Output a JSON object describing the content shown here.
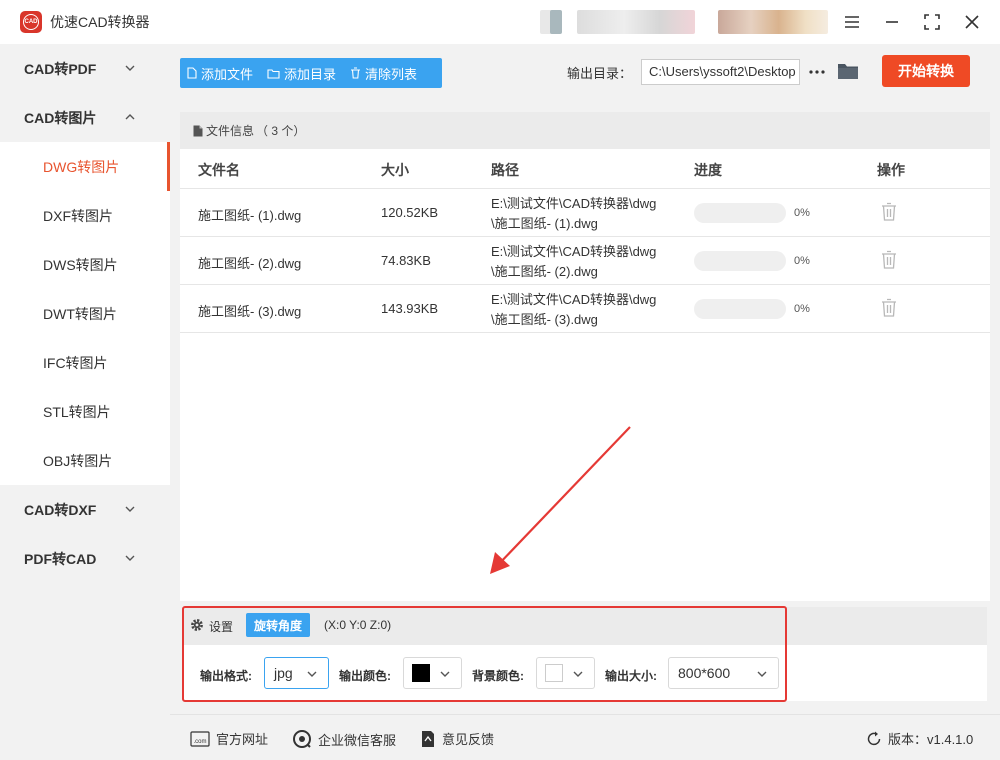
{
  "app": {
    "title": "优速CAD转换器",
    "logo_text": "CAD"
  },
  "sidebar": {
    "groups": [
      {
        "label": "CAD转PDF"
      },
      {
        "label": "CAD转图片"
      },
      {
        "label": "CAD转DXF"
      },
      {
        "label": "PDF转CAD"
      }
    ],
    "items": [
      {
        "label": "DWG转图片"
      },
      {
        "label": "DXF转图片"
      },
      {
        "label": "DWS转图片"
      },
      {
        "label": "DWT转图片"
      },
      {
        "label": "IFC转图片"
      },
      {
        "label": "STL转图片"
      },
      {
        "label": "OBJ转图片"
      }
    ],
    "active_item": "DWG转图片"
  },
  "toolbar": {
    "add_file": "添加文件",
    "add_dir": "添加目录",
    "clear_list": "清除列表",
    "output_label": "输出目录：",
    "output_path": "C:\\Users\\yssoft2\\Desktop",
    "start_button": "开始转换"
  },
  "file_panel": {
    "title": "文件信息",
    "count": "（ 3 个）",
    "columns": {
      "name": "文件名",
      "size": "大小",
      "path": "路径",
      "progress": "进度",
      "action": "操作"
    },
    "rows": [
      {
        "name": "施工图纸- (1).dwg",
        "size": "120.52KB",
        "path": "E:\\测试文件\\CAD转换器\\dwg\\施工图纸- (1).dwg",
        "progress": 0,
        "progress_label": "0%"
      },
      {
        "name": "施工图纸- (2).dwg",
        "size": "74.83KB",
        "path": "E:\\测试文件\\CAD转换器\\dwg\\施工图纸- (2).dwg",
        "progress": 0,
        "progress_label": "0%"
      },
      {
        "name": "施工图纸- (3).dwg",
        "size": "143.93KB",
        "path": "E:\\测试文件\\CAD转换器\\dwg\\施工图纸- (3).dwg",
        "progress": 0,
        "progress_label": "0%"
      }
    ]
  },
  "settings": {
    "label": "设置",
    "rotate_button": "旋转角度",
    "rotation_readout": "(X:0 Y:0 Z:0)",
    "format_label": "输出格式:",
    "format_value": "jpg",
    "color_label": "输出颜色:",
    "color_value": "#000000",
    "bg_label": "背景颜色:",
    "bg_value": "#ffffff",
    "size_label": "输出大小:",
    "size_value": "800*600"
  },
  "footer": {
    "website": "官方网址",
    "wechat": "企业微信客服",
    "feedback": "意见反馈",
    "version": "版本：v1.4.1.0"
  },
  "colors": {
    "accent": "#3aa3f0",
    "primary": "#ef4a25",
    "active": "#e8542f",
    "highlight": "#e53935"
  }
}
